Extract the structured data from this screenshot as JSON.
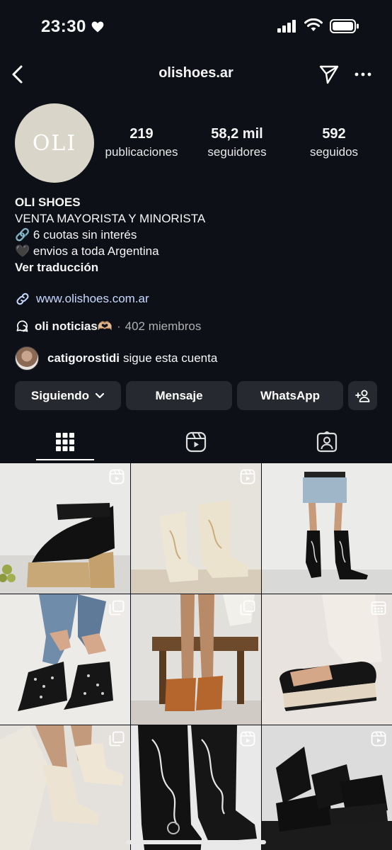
{
  "status_bar": {
    "time": "23:30"
  },
  "header": {
    "username": "olishoes.ar"
  },
  "profile": {
    "avatar_text": "OLI",
    "stats": [
      {
        "num": "219",
        "label": "publicaciones"
      },
      {
        "num": "58,2 mil",
        "label": "seguidores"
      },
      {
        "num": "592",
        "label": "seguidos"
      }
    ],
    "name": "OLI SHOES",
    "bio_lines": [
      "VENTA MAYORISTA Y MINORISTA",
      "🔗 6 cuotas sin interés",
      "🖤 envios a toda Argentina"
    ],
    "translate": "Ver traducción",
    "link": "www.olishoes.com.ar",
    "channel": {
      "name": "oli noticias🫶🏼",
      "sep": "·",
      "members": "402 miembros"
    },
    "followed_by": {
      "user": "catigorostidi",
      "text": "sigue esta cuenta"
    }
  },
  "buttons": {
    "following": "Siguiendo",
    "message": "Mensaje",
    "whatsapp": "WhatsApp"
  },
  "tabs": [
    "grid-tab",
    "reels-tab",
    "tagged-tab"
  ],
  "colors": {
    "background": "#0d1117",
    "button": "#262a30",
    "link": "#c9d8ff",
    "avatar": "#d9d6c9"
  },
  "grid": [
    {
      "badge": "reel-icon"
    },
    {
      "badge": "reel-icon"
    },
    {
      "badge": "reel-icon"
    },
    {
      "badge": "carousel-icon"
    },
    {
      "badge": "carousel-icon"
    },
    {
      "badge": "calendar-icon"
    },
    {
      "badge": "carousel-icon"
    },
    {
      "badge": "reel-icon"
    },
    {
      "badge": "reel-icon"
    }
  ]
}
